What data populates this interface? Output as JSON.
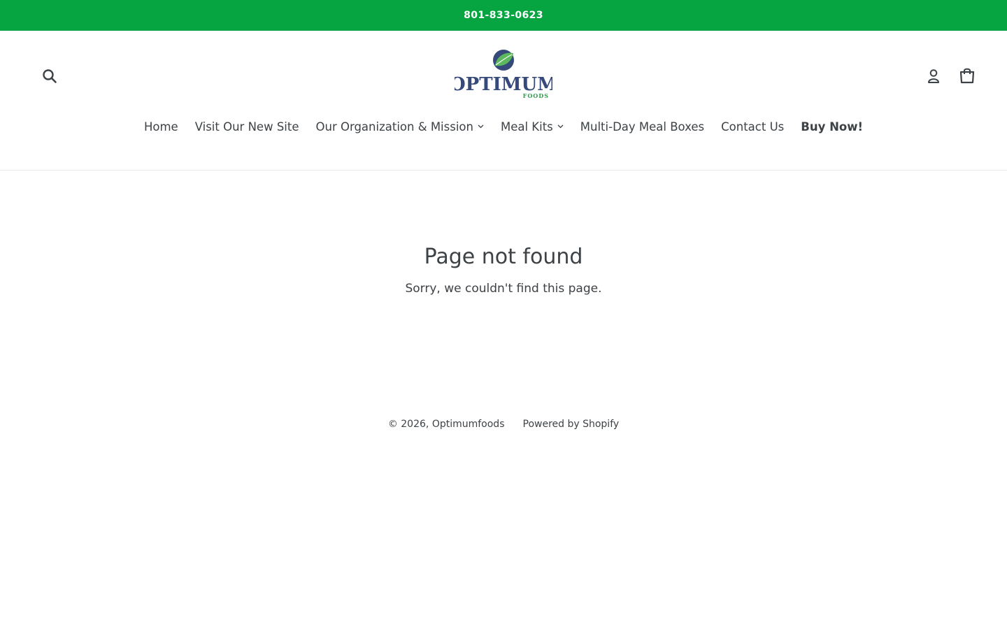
{
  "announcement": {
    "phone": "801-833-0623"
  },
  "header": {
    "search_icon": "search-icon",
    "login_icon": "user-icon",
    "cart_icon": "shopping-bag-icon",
    "logo": {
      "text": "OPTIMUM",
      "subtext": "FOODS"
    }
  },
  "nav": {
    "items": [
      {
        "label": "Home"
      },
      {
        "label": "Visit Our New Site"
      },
      {
        "label": "Our Organization & Mission"
      },
      {
        "label": "Meal Kits"
      },
      {
        "label": "Multi-Day Meal Boxes"
      },
      {
        "label": "Contact Us"
      },
      {
        "label": "Buy Now!"
      }
    ]
  },
  "main": {
    "title": "Page not found",
    "subtitle": "Sorry, we couldn't find this page."
  },
  "footer": {
    "copyright_prefix": "© 2026,",
    "store_name": "Optimumfoods",
    "powered": "Powered by Shopify"
  },
  "colors": {
    "announcement_bg": "#07a542",
    "text": "#3d4246",
    "logo_blue": "#354a7a",
    "logo_green": "#2e9e4a"
  }
}
